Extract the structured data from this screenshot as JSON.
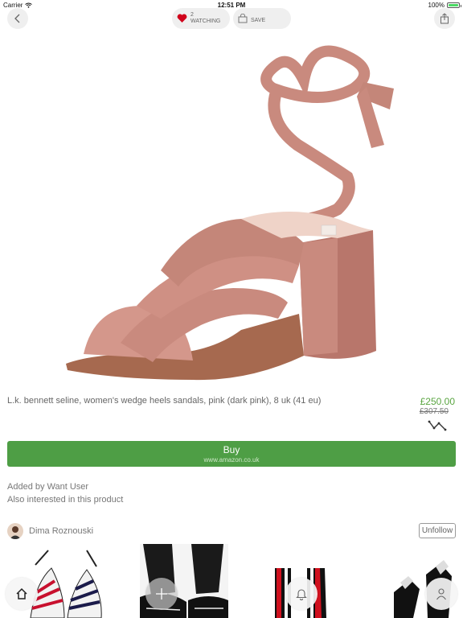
{
  "status_bar": {
    "carrier": "Carrier",
    "time": "12:51 PM",
    "battery": "100%"
  },
  "top_bar": {
    "watching_count": "2",
    "watching_label": "WATCHING",
    "save_label": "SAVE"
  },
  "product": {
    "title": "L.k. bennett seline, women's wedge heels sandals, pink (dark pink), 8 uk (41 eu)",
    "price": "£250.00",
    "old_price": "£307.50"
  },
  "buy": {
    "label": "Buy",
    "store": "www.amazon.co.uk"
  },
  "social": {
    "added_by": "Added by Want User",
    "also_interested": "Also interested in this product",
    "user_name": "Dima Roznouski",
    "unfollow_label": "Unfollow"
  },
  "icons": {
    "back": "chevron-left-icon",
    "share": "share-icon",
    "heart": "heart-icon",
    "bag": "bag-icon",
    "trend": "price-trend-icon",
    "home": "home-icon",
    "add": "plus-icon",
    "bell": "bell-icon",
    "profile": "person-icon"
  },
  "colors": {
    "accent_green": "#4e9e45",
    "price_green": "#5aa541",
    "heart_red": "#d0021b",
    "shoe_pink": "#c98a7e"
  }
}
